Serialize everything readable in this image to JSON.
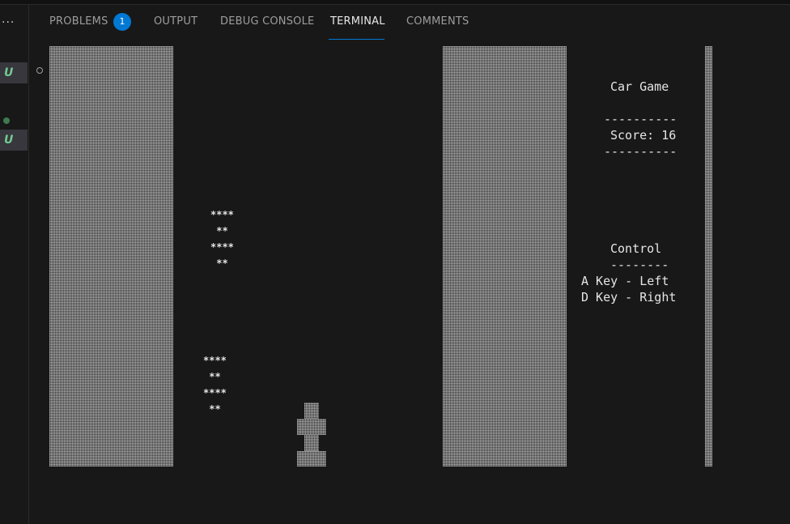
{
  "left_sidebar": {
    "more_glyph": "···",
    "untracked_labels": [
      "U",
      "U"
    ]
  },
  "panel": {
    "tabs": [
      {
        "label": "PROBLEMS",
        "active": false
      },
      {
        "label": "OUTPUT",
        "active": false
      },
      {
        "label": "DEBUG CONSOLE",
        "active": false
      },
      {
        "label": "TERMINAL",
        "active": true
      },
      {
        "label": "COMMENTS",
        "active": false
      }
    ],
    "problems_count": "1",
    "accent_color": "#0078d4"
  },
  "terminal": {
    "title": "Car Game",
    "divider": "----------",
    "score": "Score: 16",
    "control_title": "Control",
    "control_divider": "--------",
    "left_key": "A Key - Left",
    "right_key": "D Key - Right",
    "enemy_car_1": [
      "****",
      " ** ",
      "****",
      " ** "
    ],
    "enemy_car_2": [
      "****",
      " ** ",
      "****",
      " ** "
    ]
  }
}
